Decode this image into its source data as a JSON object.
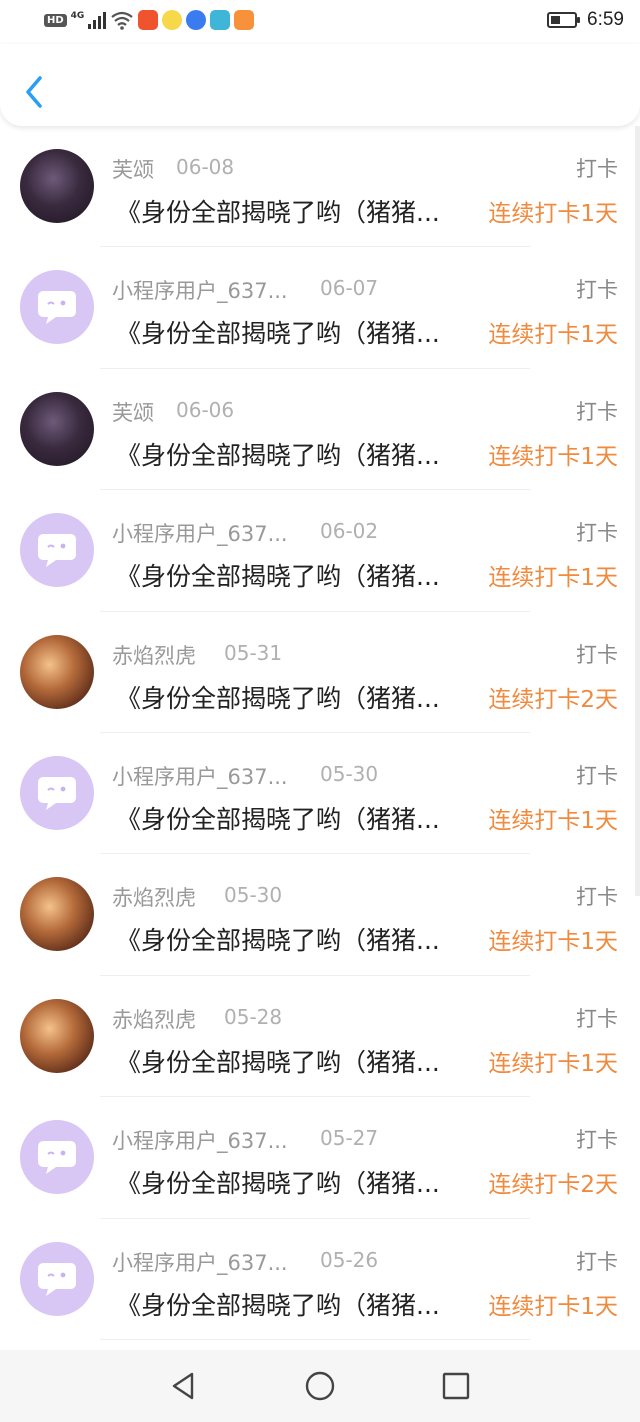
{
  "status_bar": {
    "time": "6:59",
    "hd": "HD",
    "network": "4G",
    "icons": [
      "signal-icon",
      "wifi-icon",
      "app-icon-red",
      "app-icon-yellow",
      "app-icon-blue",
      "app-icon-teal",
      "app-icon-orange",
      "battery-icon"
    ]
  },
  "header": {
    "back_icon": "chevron-left-icon",
    "accent": "#2a9df4"
  },
  "list": {
    "items": [
      {
        "avatar": "photo1",
        "name": "芙颂",
        "date": "06-08",
        "type": "打卡",
        "content": "《身份全部揭晓了哟（猪猪...",
        "streak": "连续打卡1天"
      },
      {
        "avatar": "default",
        "name": "小程序用户_637...",
        "date": "06-07",
        "type": "打卡",
        "content": "《身份全部揭晓了哟（猪猪...",
        "streak": "连续打卡1天"
      },
      {
        "avatar": "photo1",
        "name": "芙颂",
        "date": "06-06",
        "type": "打卡",
        "content": "《身份全部揭晓了哟（猪猪...",
        "streak": "连续打卡1天"
      },
      {
        "avatar": "default",
        "name": "小程序用户_637...",
        "date": "06-02",
        "type": "打卡",
        "content": "《身份全部揭晓了哟（猪猪...",
        "streak": "连续打卡1天"
      },
      {
        "avatar": "photo2",
        "name": "赤焰烈虎",
        "date": "05-31",
        "type": "打卡",
        "content": "《身份全部揭晓了哟（猪猪...",
        "streak": "连续打卡2天"
      },
      {
        "avatar": "default",
        "name": "小程序用户_637...",
        "date": "05-30",
        "type": "打卡",
        "content": "《身份全部揭晓了哟（猪猪...",
        "streak": "连续打卡1天"
      },
      {
        "avatar": "photo2",
        "name": "赤焰烈虎",
        "date": "05-30",
        "type": "打卡",
        "content": "《身份全部揭晓了哟（猪猪...",
        "streak": "连续打卡1天"
      },
      {
        "avatar": "photo2",
        "name": "赤焰烈虎",
        "date": "05-28",
        "type": "打卡",
        "content": "《身份全部揭晓了哟（猪猪...",
        "streak": "连续打卡1天"
      },
      {
        "avatar": "default",
        "name": "小程序用户_637...",
        "date": "05-27",
        "type": "打卡",
        "content": "《身份全部揭晓了哟（猪猪...",
        "streak": "连续打卡2天"
      },
      {
        "avatar": "default",
        "name": "小程序用户_637...",
        "date": "05-26",
        "type": "打卡",
        "content": "《身份全部揭晓了哟（猪猪...",
        "streak": "连续打卡1天"
      }
    ]
  },
  "nav_bar": {
    "icons": [
      "back-triangle-icon",
      "home-circle-icon",
      "recents-square-icon"
    ]
  },
  "colors": {
    "accent_orange": "#f08a3e",
    "avatar_default": "#d8c6f5"
  }
}
